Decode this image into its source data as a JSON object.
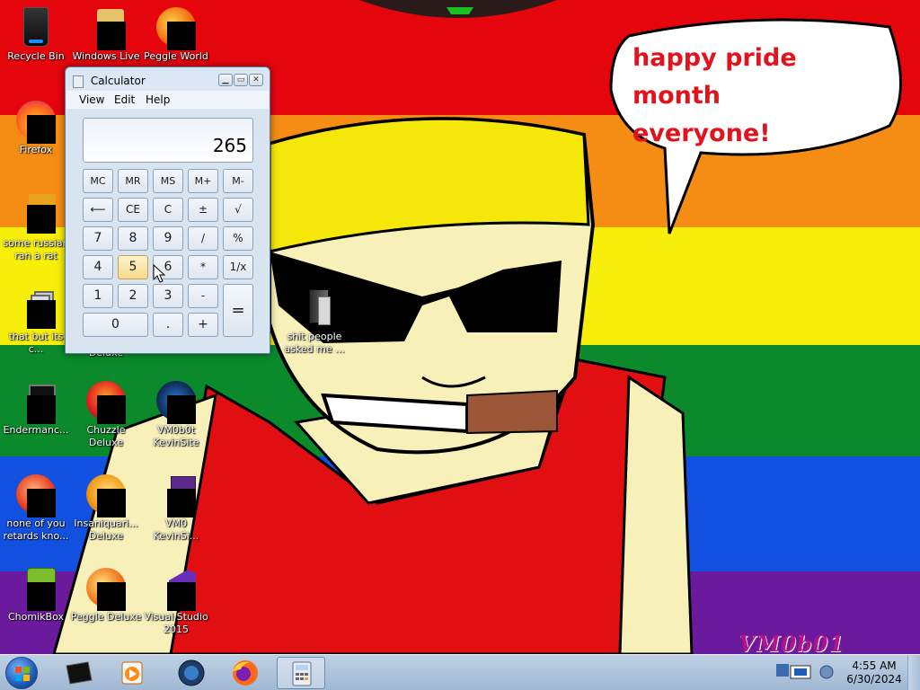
{
  "wallpaper": {
    "speech_bubble_lines": [
      "happy pride month",
      "everyone!"
    ],
    "signature": "VM0b01"
  },
  "desktop_icons": [
    {
      "label": "Recycle Bin"
    },
    {
      "label": "Windows Live"
    },
    {
      "label": "Peggle World"
    },
    {
      "label": "Firefox"
    },
    {
      "label": "some russian\nran a rat"
    },
    {
      "label": "that but its c..."
    },
    {
      "label": "Deluxe"
    },
    {
      "label": "shit people\nasked me ..."
    },
    {
      "label": "Endermanc..."
    },
    {
      "label": "Chuzzle\nDeluxe"
    },
    {
      "label": "VM0b0t\nKevinSite"
    },
    {
      "label": "none of you\nretards kno..."
    },
    {
      "label": "Insaniquari...\nDeluxe"
    },
    {
      "label": "VM0\nKevinSi..."
    },
    {
      "label": "ChomikBox"
    },
    {
      "label": "Peggle Deluxe"
    },
    {
      "label": "Visual Studio\n2015"
    }
  ],
  "calculator": {
    "title": "Calculator",
    "menu": [
      "View",
      "Edit",
      "Help"
    ],
    "display": "265",
    "buttons": {
      "mc": "MC",
      "mr": "MR",
      "ms": "MS",
      "mplus": "M+",
      "mminus": "M-",
      "back": "⟵",
      "ce": "CE",
      "c": "C",
      "plusminus": "±",
      "sqrt": "√",
      "n7": "7",
      "n8": "8",
      "n9": "9",
      "div": "/",
      "pct": "%",
      "n4": "4",
      "n5": "5",
      "n6": "6",
      "mul": "*",
      "recip": "1/x",
      "n1": "1",
      "n2": "2",
      "n3": "3",
      "sub": "-",
      "eq": "=",
      "n0": "0",
      "dot": ".",
      "add": "+"
    },
    "window_buttons": {
      "minimize": "▁",
      "maximize": "▭",
      "close": "✕"
    }
  },
  "taskbar": {
    "clock_time": "4:55 AM",
    "clock_date": "6/30/2024"
  }
}
